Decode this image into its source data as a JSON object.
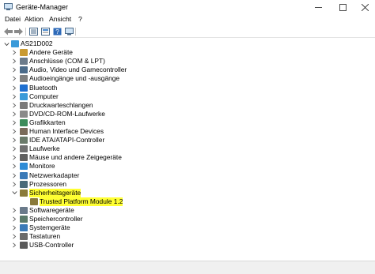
{
  "window": {
    "title": "Geräte-Manager"
  },
  "menu": [
    "Datei",
    "Aktion",
    "Ansicht",
    "?"
  ],
  "toolbar": [
    "back-icon",
    "forward-icon",
    "tree-view-icon",
    "properties-icon",
    "help-icon",
    "display-device-icon",
    "monitor-icon"
  ],
  "tree": {
    "root": "AS21D002",
    "items": [
      {
        "label": "Andere Geräte",
        "icon": "unknown-device-icon",
        "color": "#c99a32"
      },
      {
        "label": "Anschlüsse (COM & LPT)",
        "icon": "port-icon",
        "color": "#6b7b8b"
      },
      {
        "label": "Audio, Video und Gamecontroller",
        "icon": "audio-icon",
        "color": "#4b6b8a"
      },
      {
        "label": "Audioeingänge und -ausgänge",
        "icon": "speaker-icon",
        "color": "#808080"
      },
      {
        "label": "Bluetooth",
        "icon": "bluetooth-icon",
        "color": "#1e6fd0"
      },
      {
        "label": "Computer",
        "icon": "computer-icon",
        "color": "#3a9ad9"
      },
      {
        "label": "Druckwarteschlangen",
        "icon": "printer-icon",
        "color": "#7a7a7a"
      },
      {
        "label": "DVD/CD-ROM-Laufwerke",
        "icon": "disc-drive-icon",
        "color": "#8a8a8a"
      },
      {
        "label": "Grafikkarten",
        "icon": "display-adapter-icon",
        "color": "#3c8c5a"
      },
      {
        "label": "Human Interface Devices",
        "icon": "hid-icon",
        "color": "#7a6b5a"
      },
      {
        "label": "IDE ATA/ATAPI-Controller",
        "icon": "ide-controller-icon",
        "color": "#6a7a6a"
      },
      {
        "label": "Laufwerke",
        "icon": "drive-icon",
        "color": "#707070"
      },
      {
        "label": "Mäuse und andere Zeigegeräte",
        "icon": "mouse-icon",
        "color": "#606060"
      },
      {
        "label": "Monitore",
        "icon": "monitor-icon",
        "color": "#2e8bd6"
      },
      {
        "label": "Netzwerkadapter",
        "icon": "network-adapter-icon",
        "color": "#3a7ab8"
      },
      {
        "label": "Prozessoren",
        "icon": "processor-icon",
        "color": "#4a6a7a"
      },
      {
        "label": "Sicherheitsgeräte",
        "icon": "security-device-icon",
        "color": "#8a7a3a",
        "expanded": true,
        "highlight": true
      },
      {
        "label": "Trusted Platform Module 1.2",
        "icon": "tpm-icon",
        "color": "#8a7a3a",
        "child": true,
        "highlight": true
      },
      {
        "label": "Softwaregeräte",
        "icon": "software-device-icon",
        "color": "#6a7a8a"
      },
      {
        "label": "Speichercontroller",
        "icon": "storage-controller-icon",
        "color": "#5a7a6a"
      },
      {
        "label": "Systemgeräte",
        "icon": "system-device-icon",
        "color": "#3a7ab8"
      },
      {
        "label": "Tastaturen",
        "icon": "keyboard-icon",
        "color": "#6a6a6a"
      },
      {
        "label": "USB-Controller",
        "icon": "usb-icon",
        "color": "#5a5a5a"
      }
    ]
  }
}
